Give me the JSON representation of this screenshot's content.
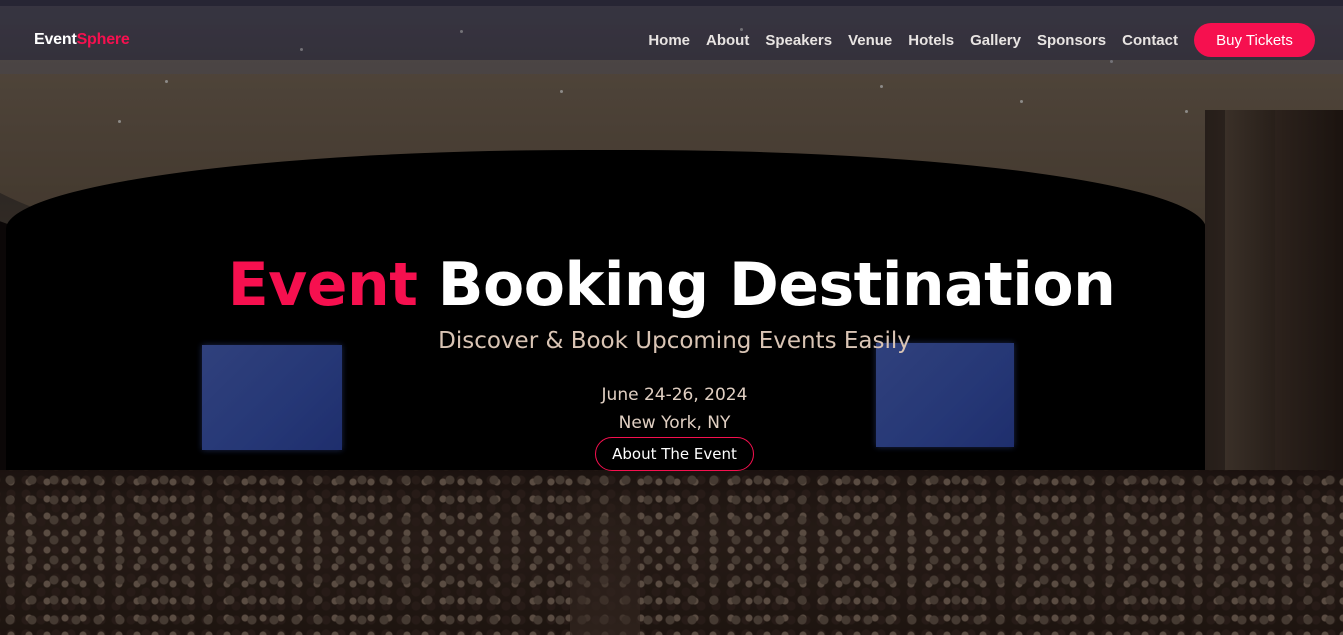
{
  "brand": {
    "name_part1": "Event",
    "name_part2": "Sphere",
    "accent_color": "#f6104f"
  },
  "nav": {
    "links": [
      {
        "label": "Home"
      },
      {
        "label": "About"
      },
      {
        "label": "Speakers"
      },
      {
        "label": "Venue"
      },
      {
        "label": "Hotels"
      },
      {
        "label": "Gallery"
      },
      {
        "label": "Sponsors"
      },
      {
        "label": "Contact"
      }
    ],
    "cta_label": "Buy Tickets"
  },
  "hero": {
    "title_accent": "Event",
    "title_rest": "Booking Destination",
    "subtitle": "Discover & Book Upcoming Events Easily",
    "date": "June 24-26, 2024",
    "location": "New York, NY",
    "button_label": "About The Event",
    "background_image": "conference-hall-audience"
  }
}
